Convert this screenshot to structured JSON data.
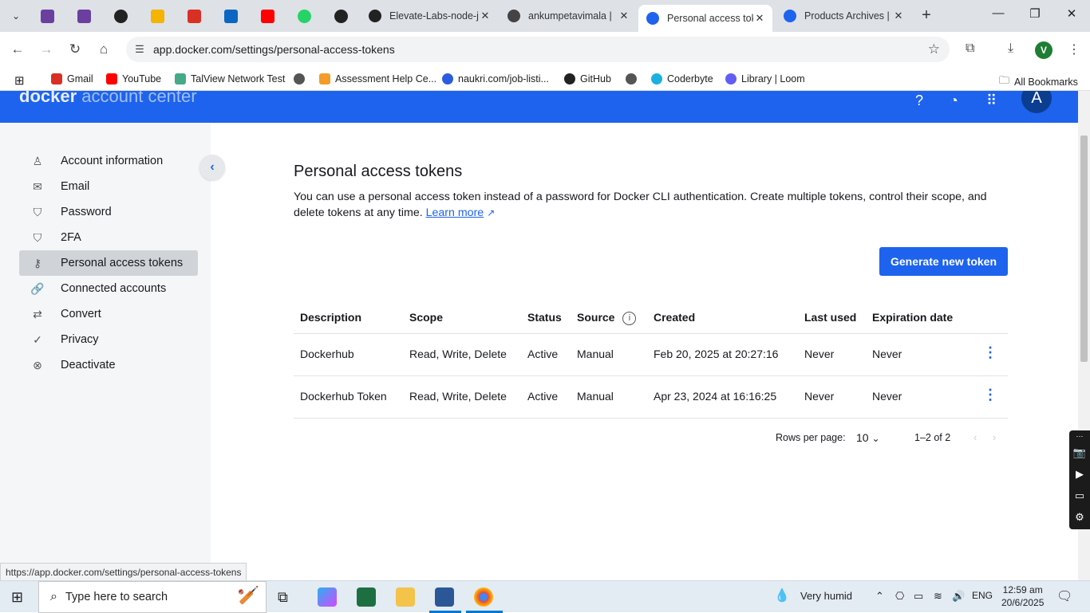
{
  "browser": {
    "tabs": [
      {
        "title": "Elevate-Labs-node-j",
        "icon": "github-icon"
      },
      {
        "title": "ankumpetavimala |",
        "icon": "profile-icon"
      },
      {
        "title": "Personal access tok",
        "icon": "docker-icon",
        "active": true
      },
      {
        "title": "Products Archives |",
        "icon": "docker-icon"
      }
    ],
    "url": "app.docker.com/settings/personal-access-tokens",
    "profile_initial": "V",
    "bookmarks": [
      {
        "label": "Gmail",
        "color": "#d93025"
      },
      {
        "label": "YouTube",
        "color": "#ff0000"
      },
      {
        "label": "TalView Network Test",
        "color": "#4a8"
      },
      {
        "label": "",
        "color": "#555"
      },
      {
        "label": "Assessment Help Ce...",
        "color": "#f49b2a"
      },
      {
        "label": "naukri.com/job-listi...",
        "color": "#2b5be0"
      },
      {
        "label": "GitHub",
        "color": "#222"
      },
      {
        "label": "",
        "color": "#555"
      },
      {
        "label": "Coderbyte",
        "color": "#1ab0e0"
      },
      {
        "label": "Library | Loom",
        "color": "#625df5"
      }
    ],
    "all_bookmarks": "All Bookmarks"
  },
  "header": {
    "logo": "docker",
    "logo_sub": "account center",
    "avatar": "A"
  },
  "sidebar": {
    "items": [
      {
        "label": "Account information",
        "icon": "person-icon",
        "glyph": "♙"
      },
      {
        "label": "Email",
        "icon": "mail-icon",
        "glyph": "✉"
      },
      {
        "label": "Password",
        "icon": "shield-icon",
        "glyph": "⛉"
      },
      {
        "label": "2FA",
        "icon": "shield-check-icon",
        "glyph": "⛉"
      },
      {
        "label": "Personal access tokens",
        "icon": "key-icon",
        "glyph": "⚷",
        "selected": true
      },
      {
        "label": "Connected accounts",
        "icon": "link-icon",
        "glyph": "🔗"
      },
      {
        "label": "Convert",
        "icon": "swap-icon",
        "glyph": "⇄"
      },
      {
        "label": "Privacy",
        "icon": "privacy-icon",
        "glyph": "✓"
      },
      {
        "label": "Deactivate",
        "icon": "cancel-circle-icon",
        "glyph": "⊗"
      }
    ]
  },
  "main": {
    "title": "Personal access tokens",
    "description": "You can use a personal access token instead of a password for Docker CLI authentication. Create multiple tokens, control their scope, and delete tokens at any time.",
    "learn_more": "Learn more",
    "generate_button": "Generate new token",
    "table": {
      "headers": [
        "Description",
        "Scope",
        "Status",
        "Source",
        "Created",
        "Last used",
        "Expiration date"
      ],
      "rows": [
        [
          "Dockerhub",
          "Read, Write, Delete",
          "Active",
          "Manual",
          "Feb 20, 2025 at 20:27:16",
          "Never",
          "Never"
        ],
        [
          "Dockerhub Token",
          "Read, Write, Delete",
          "Active",
          "Manual",
          "Apr 23, 2024 at 16:16:25",
          "Never",
          "Never"
        ]
      ]
    },
    "pagination": {
      "rows_per_page_label": "Rows per page:",
      "rows_per_page": "10",
      "range": "1–2 of 2"
    }
  },
  "status_url": "https://app.docker.com/settings/personal-access-tokens",
  "taskbar": {
    "search_placeholder": "Type here to search",
    "weather": "Very humid",
    "language": "ENG",
    "time": "12:59 am",
    "date": "20/6/2025"
  }
}
